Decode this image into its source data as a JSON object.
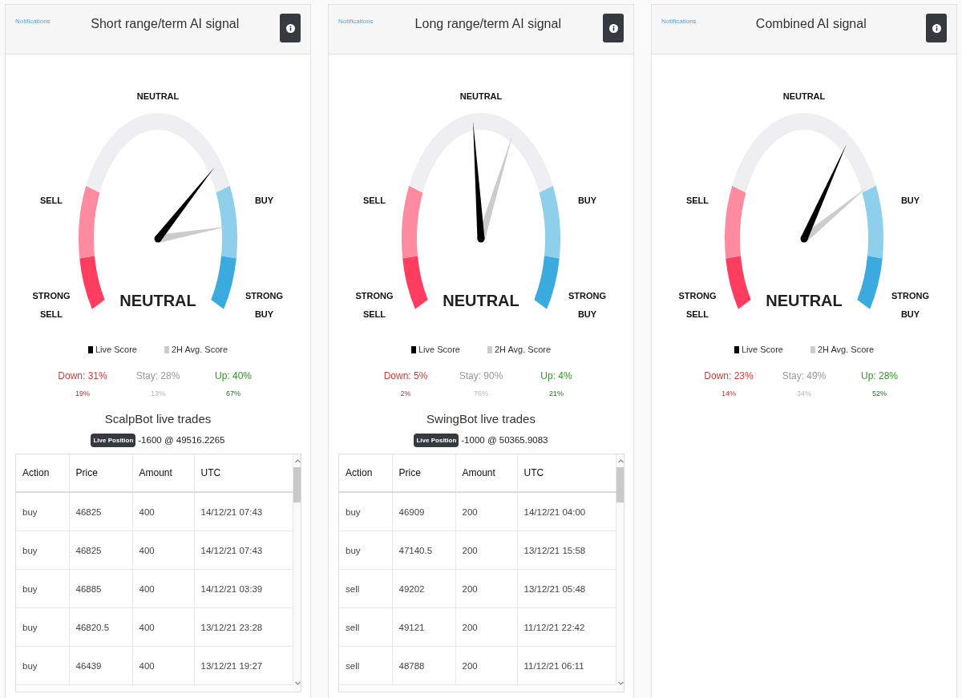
{
  "panels": [
    {
      "notifications_link": "Notifications",
      "title": "Short range/term AI signal",
      "gauge": {
        "labels": {
          "neutral": "NEUTRAL",
          "sell": "SELL",
          "buy": "BUY",
          "strong_sell": "STRONG SELL",
          "strong_buy": "STRONG BUY"
        },
        "reading": "NEUTRAL"
      },
      "legend": [
        {
          "label": "Live Score",
          "color": "#000000"
        },
        {
          "label": "2H Avg. Score",
          "color": "#cccccc"
        }
      ],
      "stats": [
        {
          "kind": "down",
          "label": "Down: 31%",
          "average": "19%"
        },
        {
          "kind": "stay",
          "label": "Stay: 28%",
          "average": "13%"
        },
        {
          "kind": "up",
          "label": "Up: 40%",
          "average": "67%"
        }
      ],
      "trades": {
        "title": "ScalpBot live trades",
        "position_badge": "Live Position",
        "position": "-1600 @ 49516.2265",
        "columns": [
          "Action",
          "Price",
          "Amount",
          "UTC"
        ],
        "rows": [
          [
            "buy",
            "46825",
            "400",
            "14/12/21 07:43"
          ],
          [
            "buy",
            "46825",
            "400",
            "14/12/21 07:43"
          ],
          [
            "buy",
            "46885",
            "400",
            "14/12/21 03:39"
          ],
          [
            "buy",
            "46820.5",
            "400",
            "13/12/21 23:28"
          ],
          [
            "buy",
            "46439",
            "400",
            "13/12/21 19:27"
          ]
        ]
      }
    },
    {
      "notifications_link": "Notifications",
      "title": "Long range/term AI signal",
      "gauge": {
        "labels": {
          "neutral": "NEUTRAL",
          "sell": "SELL",
          "buy": "BUY",
          "strong_sell": "STRONG SELL",
          "strong_buy": "STRONG BUY"
        },
        "reading": "NEUTRAL"
      },
      "legend": [
        {
          "label": "Live Score",
          "color": "#000000"
        },
        {
          "label": "2H Avg. Score",
          "color": "#cccccc"
        }
      ],
      "stats": [
        {
          "kind": "down",
          "label": "Down: 5%",
          "average": "2%"
        },
        {
          "kind": "stay",
          "label": "Stay: 90%",
          "average": "76%"
        },
        {
          "kind": "up",
          "label": "Up: 4%",
          "average": "21%"
        }
      ],
      "trades": {
        "title": "SwingBot live trades",
        "position_badge": "Live Position",
        "position": "-1000 @ 50365.9083",
        "columns": [
          "Action",
          "Price",
          "Amount",
          "UTC"
        ],
        "rows": [
          [
            "buy",
            "46909",
            "200",
            "14/12/21 04:00"
          ],
          [
            "buy",
            "47140.5",
            "200",
            "13/12/21 15:58"
          ],
          [
            "sell",
            "49202",
            "200",
            "13/12/21 05:48"
          ],
          [
            "sell",
            "49121",
            "200",
            "11/12/21 22:42"
          ],
          [
            "sell",
            "48788",
            "200",
            "11/12/21 06:11"
          ]
        ]
      }
    },
    {
      "notifications_link": "Notifications",
      "title": "Combined AI signal",
      "gauge": {
        "labels": {
          "neutral": "NEUTRAL",
          "sell": "SELL",
          "buy": "BUY",
          "strong_sell": "STRONG SELL",
          "strong_buy": "STRONG BUY"
        },
        "reading": "NEUTRAL"
      },
      "legend": [
        {
          "label": "Live Score",
          "color": "#000000"
        },
        {
          "label": "2H Avg. Score",
          "color": "#cccccc"
        }
      ],
      "stats": [
        {
          "kind": "down",
          "label": "Down: 23%",
          "average": "14%"
        },
        {
          "kind": "stay",
          "label": "Stay: 49%",
          "average": "34%"
        },
        {
          "kind": "up",
          "label": "Up: 28%",
          "average": "52%"
        }
      ]
    }
  ]
}
